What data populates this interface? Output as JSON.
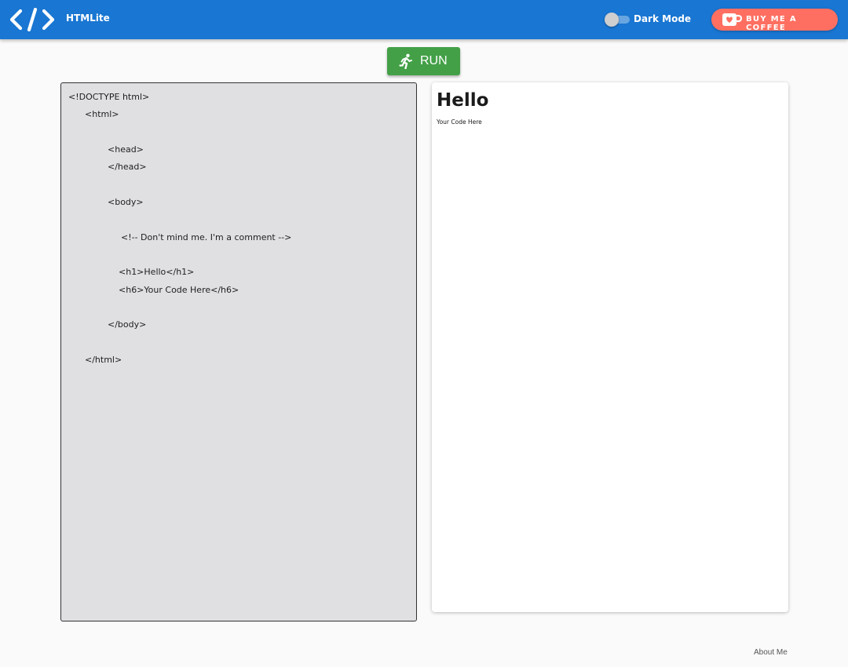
{
  "header": {
    "logo_icon": "code-brackets-icon",
    "app_title": "HTMLite",
    "dark_mode_label": "Dark Mode",
    "dark_mode_on": false,
    "coffee_icon": "coffee-cup-heart-icon",
    "coffee_label": "BUY ME A COFFEE"
  },
  "toolbar": {
    "run_icon": "running-person-icon",
    "run_label": "RUN"
  },
  "editor": {
    "lines": [
      "<!DOCTYPE html>",
      "<html>",
      "<head>",
      "</head>",
      "<body>",
      "<!-- Don't mind me. I'm a comment -->",
      "<h1>Hello</h1>",
      "<h6>Your Code Here</h6>",
      "</body>",
      "</html>"
    ]
  },
  "preview": {
    "heading": "Hello",
    "subheading": "Your Code Here"
  },
  "footer": {
    "about_label": "About Me"
  },
  "colors": {
    "app_bar": "#1976d2",
    "run_button": "#43a047",
    "coffee_button": "#ff6f61",
    "editor_background": "#e0dfe2"
  }
}
